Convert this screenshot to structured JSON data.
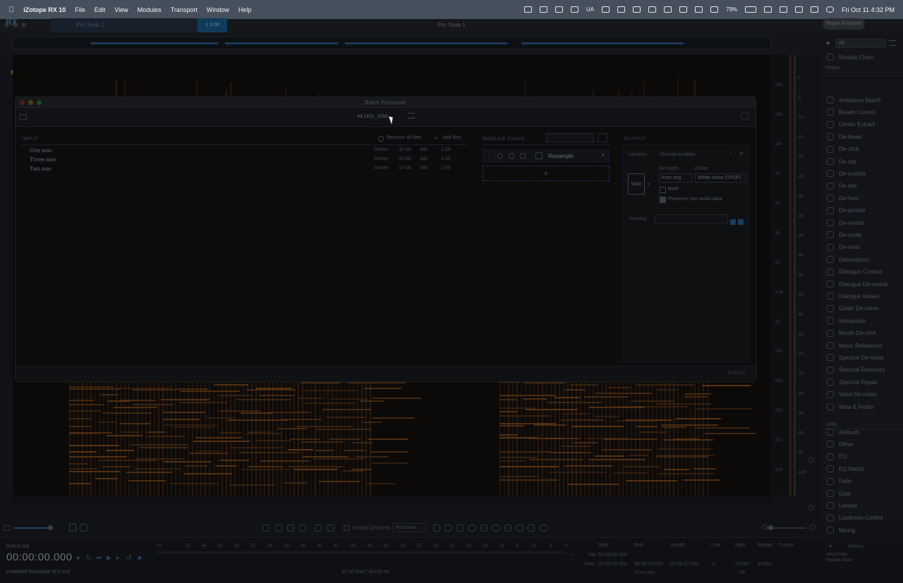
{
  "menubar": {
    "app": "iZotope RX 10",
    "items": [
      "File",
      "Edit",
      "View",
      "Modules",
      "Transport",
      "Window",
      "Help"
    ],
    "battery": "79%",
    "lang": "UA",
    "datetime": "Fri Oct 11  4:32 PM"
  },
  "window": {
    "title": "Pro Tools 1",
    "tab1": "Pro Tools 1",
    "tab2": "1 3:00",
    "repair_assistant": "Repair Assistant"
  },
  "sidebar": {
    "filter": "All",
    "module_chain": "Module Chain",
    "repair_header": "Repair",
    "repair_items": [
      "Ambience Match",
      "Breath Control",
      "Center Extract",
      "De-bleed",
      "De-click",
      "De-clip",
      "De-crackle",
      "De-ess",
      "De-hum",
      "De-plosive",
      "De-reverb",
      "De-rustle",
      "De-wind",
      "Deconstruct",
      "Dialogue Contour",
      "Dialogue De-reverb",
      "Dialogue Isolate",
      "Guitar De-noise",
      "Interpolate",
      "Mouth De-click",
      "Music Rebalance",
      "Spectral De-noise",
      "Spectral Recovery",
      "Spectral Repair",
      "Voice De-noise",
      "Wow & Flutter"
    ],
    "utility_header": "Utility",
    "utility_items": [
      "Azimuth",
      "Dither",
      "EQ",
      "EQ Match",
      "Fade",
      "Gain",
      "Leveler",
      "Loudness Control",
      "Mixing"
    ]
  },
  "batch": {
    "title": "Batch Processor",
    "preset": "44.1khz_16bit",
    "input_label": "INPUT",
    "remove_all": "Remove all files",
    "add_files": "Add files",
    "module_chain_label": "MODULE CHAIN",
    "output_label": "OUTPUT",
    "files": [
      {
        "name": "One.wav",
        "channels": "Stereo",
        "bits": "32-bit",
        "rate": "48k",
        "length": "1:30"
      },
      {
        "name": "Three.wav",
        "channels": "Stereo",
        "bits": "32-bit",
        "rate": "48k",
        "length": "1:30"
      },
      {
        "name": "Two.wav",
        "channels": "Stereo",
        "bits": "32-bit",
        "rate": "48k",
        "length": "1:30"
      }
    ],
    "module": "Resample",
    "add_module": "+",
    "location_label": "Location",
    "location_value": "Choose location...",
    "format_badge": "WAV",
    "bit_depth_label": "Bit depth",
    "bit_depth_value": "from orig",
    "dither_label": "Dither",
    "dither_value": "White noise (TPDF)",
    "bwf_label": "BWF",
    "preserve_label": "Preserve non-audio data",
    "naming_label": "Naming",
    "process": "Process"
  },
  "tools": {
    "instant_process": "Instant process",
    "attenuate": "Attenuate"
  },
  "transport": {
    "unit": "h:m:s.ms",
    "timecode": "00:00:00.000",
    "status": "Initialized Resample (8.0 ms)",
    "format": "32-bit float | 44100 Hz"
  },
  "levels": [
    "Inf",
    "-70",
    "-66",
    "-63",
    "-60",
    "-57",
    "-54",
    "-51",
    "-48",
    "-45",
    "-42",
    "-39",
    "-36",
    "-33",
    "-30",
    "-27",
    "-24",
    "-21",
    "-18",
    "-15",
    "-12",
    "-9",
    "-6",
    "-3",
    "0"
  ],
  "selection": {
    "headers": [
      "Start",
      "End",
      "Length",
      "Low",
      "High",
      "Range",
      "Cursor"
    ],
    "sel_label": "Sel",
    "view_label": "View",
    "sel_start": "00:00:00.000",
    "view_start": "00:00:00.000",
    "view_end": "00:00:27.020",
    "view_length": "00:00:27.020",
    "low": "0",
    "high": "22050",
    "range": "22050",
    "unit_time": "h:m:s.ms",
    "unit_hz": "Hz"
  },
  "history": {
    "title": "History",
    "items": [
      "Initial State",
      "Module Chain"
    ]
  },
  "freq_ticks": [
    "-20k",
    "-15k",
    "-10k",
    "-7k",
    "-5k",
    "-3k",
    "-2k",
    "-1.5k",
    "-1k",
    "-700",
    "-500",
    "-300",
    "-200",
    "-100"
  ],
  "db_ticks": [
    "0",
    "-5",
    "-10",
    "-15",
    "-20",
    "-25",
    "-30",
    "-35",
    "-40",
    "-45",
    "-50",
    "-55",
    "-60",
    "-65",
    "-70",
    "-75",
    "-80",
    "-85",
    "-90",
    "-95",
    "-100"
  ],
  "colors": {
    "accent": "#1e4466",
    "spectro": "#5a3311"
  }
}
